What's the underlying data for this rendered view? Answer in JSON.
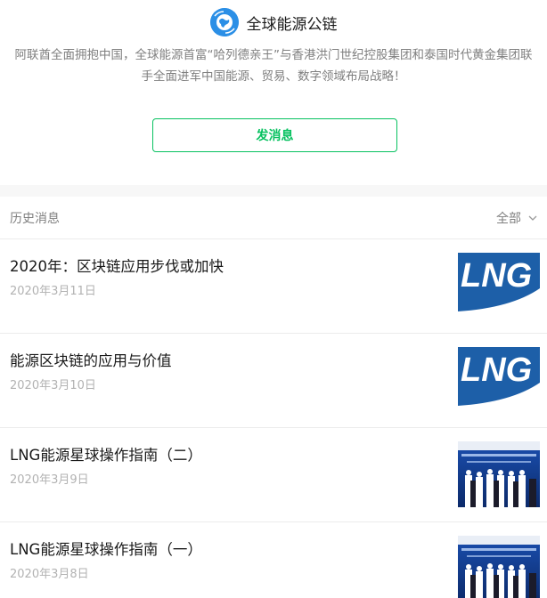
{
  "account": {
    "name": "全球能源公链",
    "avatar_icon": "globe-logo-icon",
    "description": "阿联酋全面拥抱中国，全球能源首富“哈列德亲王”与香港洪门世纪控股集团和泰国时代黄金集团联手全面进军中国能源、贸易、数字领域布局战略！"
  },
  "actions": {
    "send_message_label": "发消息"
  },
  "history": {
    "title": "历史消息",
    "filter_label": "全部",
    "filter_icon": "chevron-down-icon"
  },
  "articles": [
    {
      "title": "2020年：区块链应用步伐或加快",
      "date": "2020年3月11日",
      "thumb": "LNG"
    },
    {
      "title": "能源区块链的应用与价值",
      "date": "2020年3月10日",
      "thumb": "LNG"
    },
    {
      "title": "LNG能源星球操作指南（二）",
      "date": "2020年3月9日",
      "thumb": "event-photo"
    },
    {
      "title": "LNG能源星球操作指南（一）",
      "date": "2020年3月8日",
      "thumb": "event-photo"
    }
  ],
  "colors": {
    "accent": "#07c160",
    "lng_blue": "#1d5fa8",
    "avatar_blue": "#2b8fe6"
  }
}
